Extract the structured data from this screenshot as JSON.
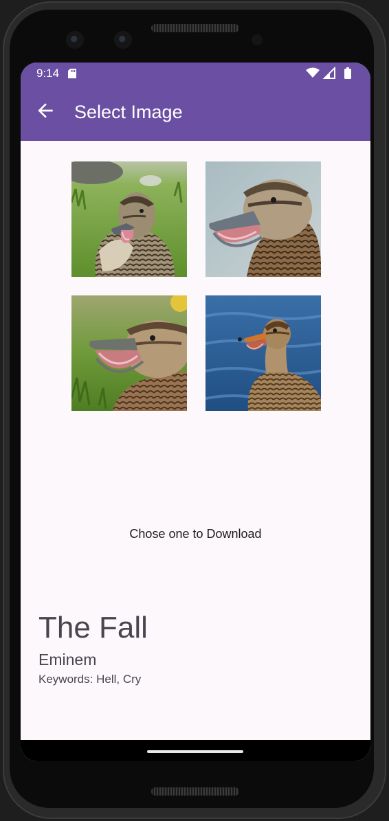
{
  "status_bar": {
    "time": "9:14",
    "icons": [
      "sd-card-icon",
      "wifi-icon",
      "cellular-signal-icon",
      "battery-icon"
    ]
  },
  "app_bar": {
    "title": "Select Image",
    "back_icon": "arrow-left-icon",
    "color": "#6a4fa3"
  },
  "images": [
    {
      "subject": "duck in grass, bill open"
    },
    {
      "subject": "duck head profile, bill open"
    },
    {
      "subject": "duck resting on grass, bill open"
    },
    {
      "subject": "duck on blue water, bill open"
    }
  ],
  "caption": "Chose one to Download",
  "song": {
    "title": "The Fall",
    "artist": "Eminem",
    "keywords_label": "Keywords:",
    "keywords": "Hell, Cry"
  }
}
